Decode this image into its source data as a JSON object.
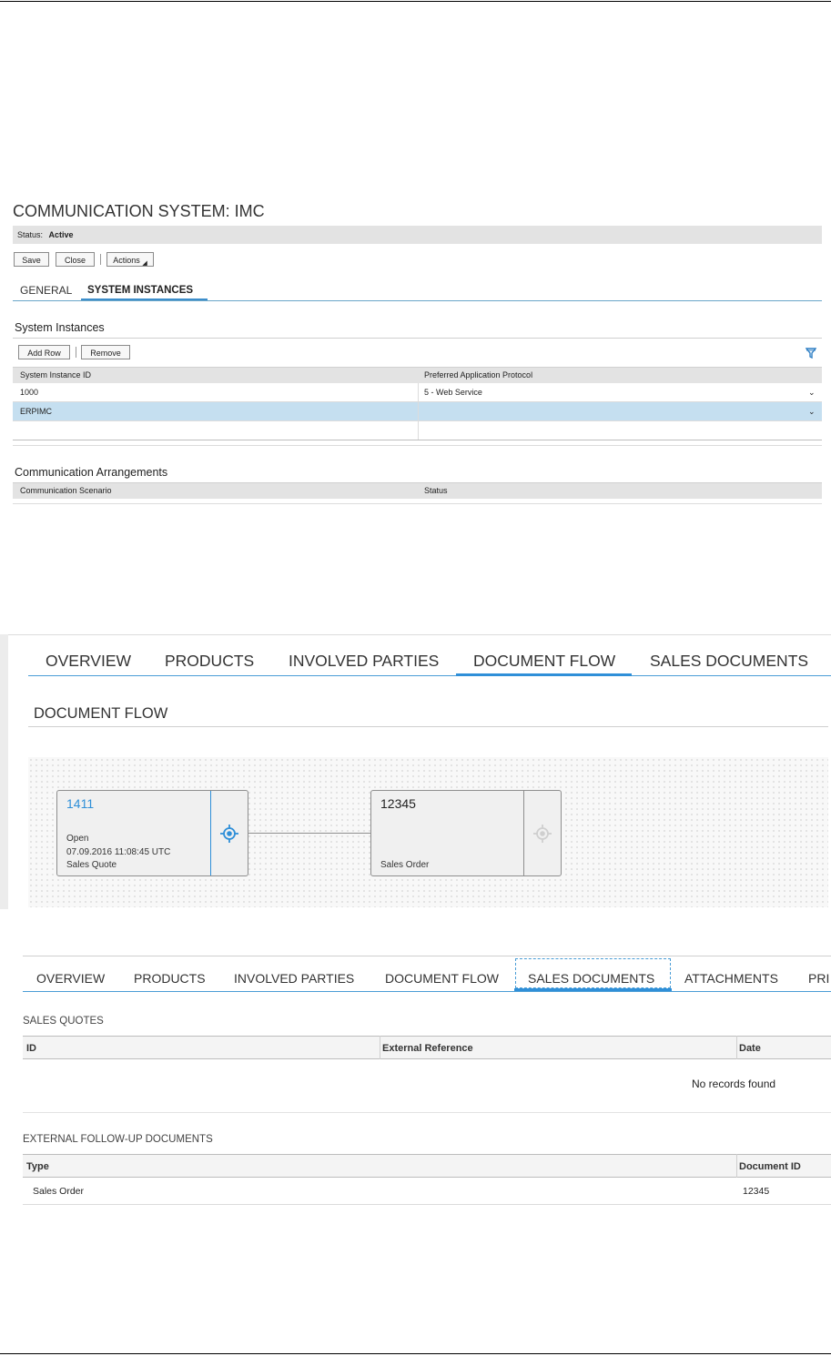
{
  "system": {
    "title": "COMMUNICATION SYSTEM: IMC",
    "status_label": "Status:",
    "status_value": "Active",
    "buttons": {
      "save": "Save",
      "close": "Close",
      "actions": "Actions"
    },
    "tabs": [
      {
        "label": "GENERAL",
        "active": false
      },
      {
        "label": "SYSTEM INSTANCES",
        "active": true
      }
    ],
    "instances": {
      "heading": "System Instances",
      "add_row": "Add Row",
      "remove": "Remove",
      "filter_icon": "filter-icon",
      "columns": [
        "System Instance ID",
        "Preferred Application Protocol"
      ],
      "rows": [
        {
          "id": "1000",
          "protocol": "5 - Web Service",
          "selected": false
        },
        {
          "id": "ERPIMC",
          "protocol": "",
          "selected": true
        }
      ]
    },
    "arrangements": {
      "heading": "Communication Arrangements",
      "columns": [
        "Communication Scenario",
        "Status"
      ]
    }
  },
  "doc_flow_view": {
    "tabs": [
      "OVERVIEW",
      "PRODUCTS",
      "INVOLVED PARTIES",
      "DOCUMENT FLOW",
      "SALES DOCUMENTS"
    ],
    "active_tab": "DOCUMENT FLOW",
    "heading": "DOCUMENT FLOW",
    "nodes": [
      {
        "id": "1411",
        "status": "Open",
        "timestamp": "07.09.2016 11:08:45 UTC",
        "type": "Sales Quote",
        "icon": "locate-icon"
      },
      {
        "id": "12345",
        "type": "Sales Order",
        "icon": "locate-icon"
      }
    ]
  },
  "sales_docs_view": {
    "tabs": [
      "OVERVIEW",
      "PRODUCTS",
      "INVOLVED PARTIES",
      "DOCUMENT FLOW",
      "SALES DOCUMENTS",
      "ATTACHMENTS",
      "PRI"
    ],
    "active_tab": "SALES DOCUMENTS",
    "quotes": {
      "heading": "SALES QUOTES",
      "columns": [
        "ID",
        "External Reference",
        "Date"
      ],
      "empty_text": "No records found"
    },
    "followups": {
      "heading": "EXTERNAL FOLLOW-UP DOCUMENTS",
      "columns": [
        "Type",
        "Document ID"
      ],
      "rows": [
        {
          "type": "Sales Order",
          "document_id": "12345"
        }
      ]
    }
  },
  "colors": {
    "accent": "#2f8fd8",
    "selected_row": "#c5dff0",
    "link": "#2f8fd8"
  }
}
